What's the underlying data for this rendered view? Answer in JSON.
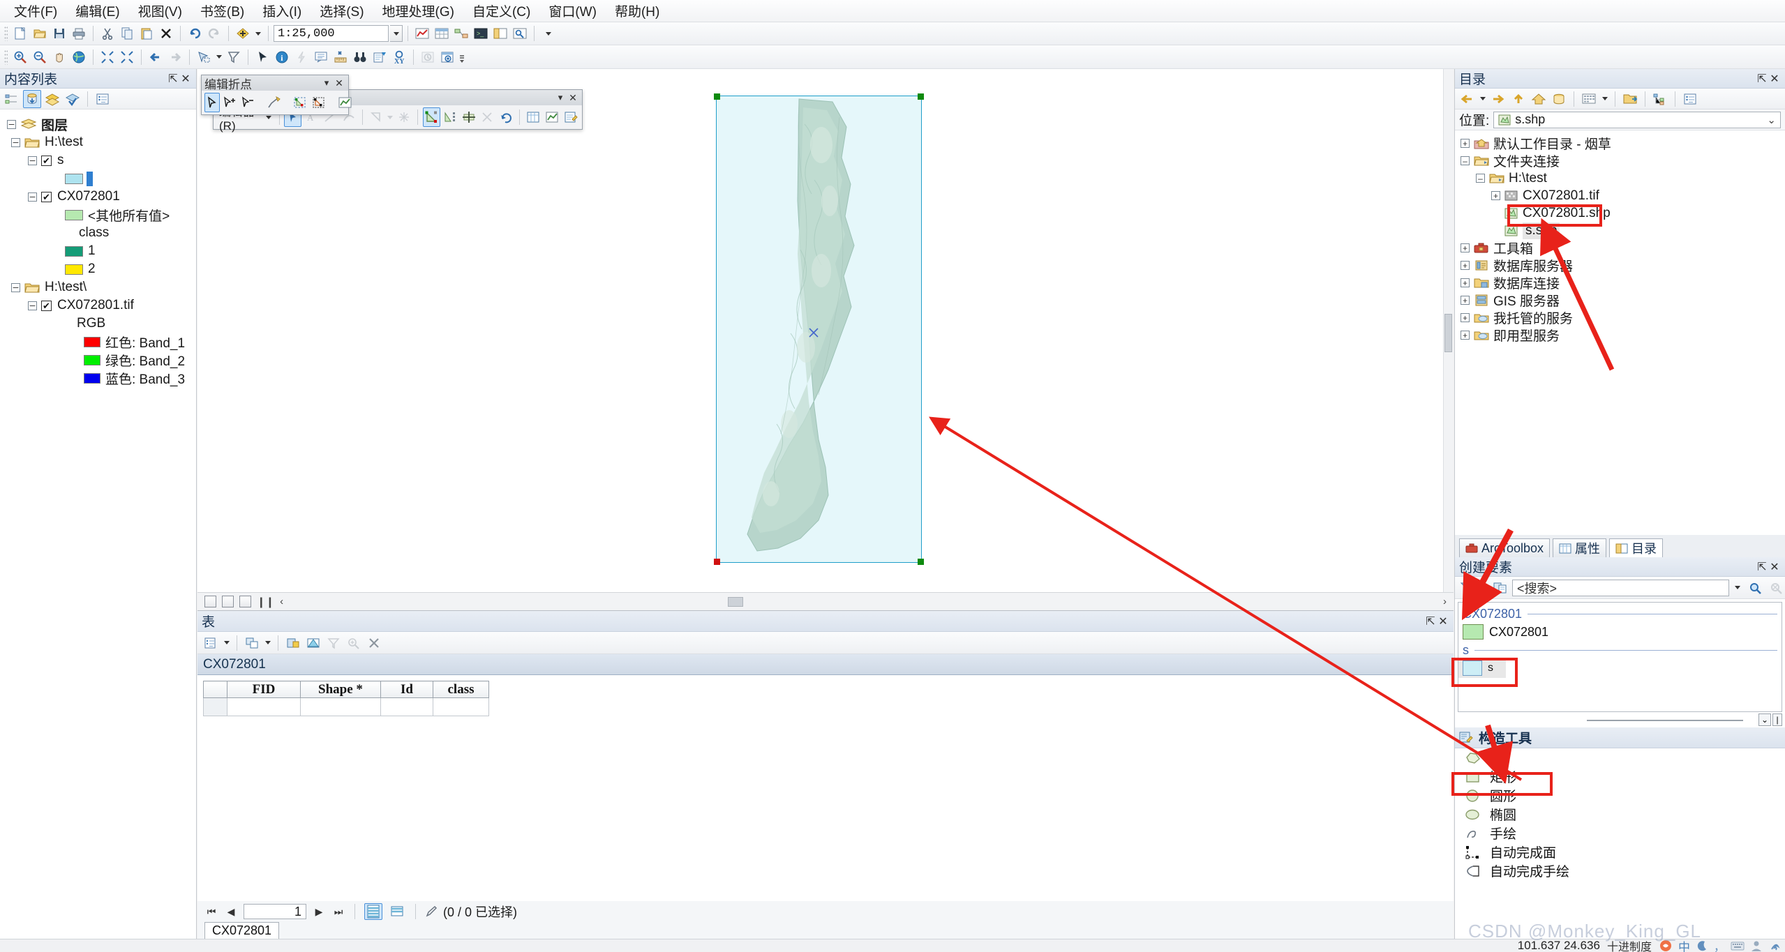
{
  "app": {
    "menu": [
      "文件(F)",
      "编辑(E)",
      "视图(V)",
      "书签(B)",
      "插入(I)",
      "选择(S)",
      "地理处理(G)",
      "自定义(C)",
      "窗口(W)",
      "帮助(H)"
    ],
    "scale": "1:25,000"
  },
  "toc": {
    "title": "内容列表",
    "tree": {
      "root": "图层",
      "folder1": "H:\\test",
      "layer_s": "s",
      "layer_cx": "CX072801",
      "other_values": "<其他所有值>",
      "field": "class",
      "class1": "1",
      "class2": "2",
      "folder2": "H:\\test\\",
      "raster": "CX072801.tif",
      "rgb": "RGB",
      "band_red": "红色:   Band_1",
      "band_green": "绿色: Band_2",
      "band_blue": "蓝色:  Band_3"
    },
    "colors": {
      "s_fill": "#aee3ef",
      "other_fill": "#b6e9b0",
      "class1_fill": "#149c77",
      "class2_fill": "#ffe800",
      "band_red": "#ff0000",
      "band_green": "#00ee00",
      "band_blue": "#0000ee"
    }
  },
  "edit_vertex_toolbar": {
    "title": "编辑折点"
  },
  "edit_toolbar": {
    "menu_label": "编辑器(R)"
  },
  "table": {
    "title": "表",
    "tab_label": "CX072801",
    "chip_label": "CX072801",
    "columns": [
      "FID",
      "Shape *",
      "Id",
      "class"
    ],
    "rows": [
      [
        "",
        "",
        "",
        ""
      ]
    ],
    "record_number": "1",
    "selection_status": "(0 / 0 已选择)"
  },
  "catalog": {
    "title": "目录",
    "location_label": "位置:",
    "location_value": "s.shp",
    "tree": [
      {
        "label": "默认工作目录 - 烟草",
        "indent": 0,
        "expand": "+",
        "icon": "home-folder-icon"
      },
      {
        "label": "文件夹连接",
        "indent": 0,
        "expand": "-",
        "icon": "folder-connection-icon"
      },
      {
        "label": "H:\\test",
        "indent": 1,
        "expand": "-",
        "icon": "folder-icon"
      },
      {
        "label": "CX072801.tif",
        "indent": 2,
        "expand": "+",
        "icon": "raster-icon"
      },
      {
        "label": "CX072801.shp",
        "indent": 2,
        "expand": "",
        "icon": "shapefile-icon"
      },
      {
        "label": "s.shp",
        "indent": 2,
        "expand": "",
        "icon": "shapefile-icon",
        "highlighted": true
      },
      {
        "label": "工具箱",
        "indent": 0,
        "expand": "+",
        "icon": "toolbox-icon"
      },
      {
        "label": "数据库服务器",
        "indent": 0,
        "expand": "+",
        "icon": "db-server-icon"
      },
      {
        "label": "数据库连接",
        "indent": 0,
        "expand": "+",
        "icon": "db-connection-icon"
      },
      {
        "label": "GIS 服务器",
        "indent": 0,
        "expand": "+",
        "icon": "gis-server-icon"
      },
      {
        "label": "我托管的服务",
        "indent": 0,
        "expand": "+",
        "icon": "hosted-service-icon"
      },
      {
        "label": "即用型服务",
        "indent": 0,
        "expand": "+",
        "icon": "ready-service-icon"
      }
    ]
  },
  "tabs": [
    {
      "label": "ArcToolbox",
      "active": false
    },
    {
      "label": "属性",
      "active": false
    },
    {
      "label": "目录",
      "active": true
    }
  ],
  "create_features": {
    "title": "创建要素",
    "search_placeholder": "<搜索>",
    "groups": [
      {
        "name": "CX072801",
        "items": [
          {
            "label": "CX072801",
            "swatch": "#b6e9b0"
          }
        ]
      },
      {
        "name": "s",
        "items": [
          {
            "label": "s",
            "swatch": "#cdeef6",
            "selected": true
          }
        ]
      }
    ]
  },
  "construction_tools": {
    "title": "构造工具",
    "items": [
      {
        "label": "面",
        "icon": "polygon-icon",
        "selected": false
      },
      {
        "label": "矩形",
        "icon": "rectangle-icon",
        "selected": true
      },
      {
        "label": "圆形",
        "icon": "circle-icon",
        "selected": false
      },
      {
        "label": "椭圆",
        "icon": "ellipse-icon",
        "selected": false
      },
      {
        "label": "手绘",
        "icon": "freehand-icon",
        "selected": false
      },
      {
        "label": "自动完成面",
        "icon": "autocomplete-polygon-icon",
        "selected": false
      },
      {
        "label": "自动完成手绘",
        "icon": "autocomplete-freehand-icon",
        "selected": false
      }
    ]
  },
  "statusbar": {
    "coords": "101.637  24.636",
    "unit": "十进制度",
    "watermark": "CSDN @Monkey_King_GL"
  },
  "colors": {
    "accent": "#4a90d9",
    "annotation_red": "#e8221a",
    "selection_cyan": "#1e9ec9"
  }
}
